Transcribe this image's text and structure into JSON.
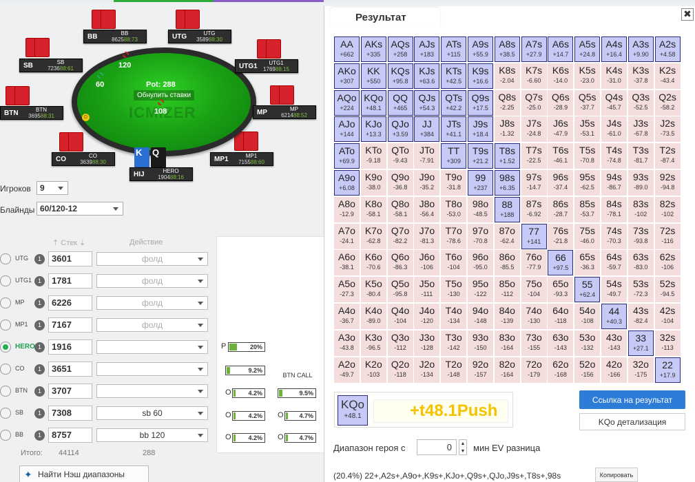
{
  "left": {
    "table": {
      "pot_label": "Pot: 288",
      "reset_label": "Обнулить ставки",
      "logo": "ICMIZER",
      "bets": {
        "bb": "120",
        "sb": "60",
        "hero": "108"
      },
      "dealer": "D",
      "hero_cards": [
        "K",
        "Q"
      ]
    },
    "seats": [
      {
        "pos": "BB",
        "name": "BB",
        "stack": "8625",
        "bb": "88:73"
      },
      {
        "pos": "UTG",
        "name": "UTG",
        "stack": "3589",
        "bb": "88:30"
      },
      {
        "pos": "UTG1",
        "name": "UTG1",
        "stack": "1769",
        "bb": "88:15"
      },
      {
        "pos": "MP",
        "name": "MP",
        "stack": "6214",
        "bb": "88:52"
      },
      {
        "pos": "MP1",
        "name": "MP1",
        "stack": "7155",
        "bb": "88:60"
      },
      {
        "pos": "HIJ",
        "name": "HERO",
        "stack": "1904",
        "bb": "88:16"
      },
      {
        "pos": "CO",
        "name": "CO",
        "stack": "3639",
        "bb": "88:30"
      },
      {
        "pos": "BTN",
        "name": "BTN",
        "stack": "3695",
        "bb": "88:31"
      },
      {
        "pos": "SB",
        "name": "SB",
        "stack": "7236",
        "bb": "88:61"
      }
    ],
    "players_label": "Игроков",
    "players_value": "9",
    "blinds_label": "Блайнды",
    "blinds_value": "60/120-12",
    "col_stack": "Стек",
    "col_action": "Действие",
    "rows": [
      {
        "pos": "UTG",
        "badge": "1",
        "stack": "3601",
        "action": "фолд"
      },
      {
        "pos": "UTG1",
        "badge": "1",
        "stack": "1781",
        "action": "фолд"
      },
      {
        "pos": "MP",
        "badge": "1",
        "stack": "6226",
        "action": "фолд"
      },
      {
        "pos": "MP1",
        "badge": "1",
        "stack": "7167",
        "action": "фолд"
      },
      {
        "pos": "HERO",
        "badge": "1",
        "stack": "1916",
        "action": ""
      },
      {
        "pos": "CO",
        "badge": "1",
        "stack": "3651",
        "action": ""
      },
      {
        "pos": "BTN",
        "badge": "1",
        "stack": "3707",
        "action": ""
      },
      {
        "pos": "SB",
        "badge": "1",
        "stack": "7308",
        "action": "sb 60"
      },
      {
        "pos": "BB",
        "badge": "1",
        "stack": "8757",
        "action": "bb 120"
      }
    ],
    "panel": {
      "p_label": "P",
      "p_pct": "20%",
      "co_pct": "9.2%",
      "btn_call": "BTN CALL",
      "btn_pct": "4.2%",
      "btn_call_pct": "9.5%",
      "sb_pct": "4.2%",
      "sb_call_pct": "4.7%",
      "bb_pct": "4.2%",
      "bb_call_pct": "4.7%",
      "o": "O"
    },
    "total_label": "Итого:",
    "total_stack": "44114",
    "total_pot": "288",
    "nash_label": "Найти Нэш диапазоны"
  },
  "right": {
    "tab": "Результат",
    "close": "✖",
    "grid": [
      [
        [
          "AA",
          "+662"
        ],
        [
          "AKs",
          "+335"
        ],
        [
          "AQs",
          "+258"
        ],
        [
          "AJs",
          "+183"
        ],
        [
          "ATs",
          "+115"
        ],
        [
          "A9s",
          "+55.9"
        ],
        [
          "A8s",
          "+38.5"
        ],
        [
          "A7s",
          "+27.9"
        ],
        [
          "A6s",
          "+14.7"
        ],
        [
          "A5s",
          "+24.8"
        ],
        [
          "A4s",
          "+16.4"
        ],
        [
          "A3s",
          "+9.90"
        ],
        [
          "A2s",
          "+4.58"
        ]
      ],
      [
        [
          "AKo",
          "+307"
        ],
        [
          "KK",
          "+550"
        ],
        [
          "KQs",
          "+95.8"
        ],
        [
          "KJs",
          "+63.6"
        ],
        [
          "KTs",
          "+42.5"
        ],
        [
          "K9s",
          "+16.6"
        ],
        [
          "K8s",
          "-2.04"
        ],
        [
          "K7s",
          "-6.60"
        ],
        [
          "K6s",
          "-14.0"
        ],
        [
          "K5s",
          "-23.0"
        ],
        [
          "K4s",
          "-31.0"
        ],
        [
          "K3s",
          "-37.8"
        ],
        [
          "K2s",
          "-43.4"
        ]
      ],
      [
        [
          "AQo",
          "+224"
        ],
        [
          "KQo",
          "+48.1"
        ],
        [
          "QQ",
          "+465"
        ],
        [
          "QJs",
          "+54.3"
        ],
        [
          "QTs",
          "+42.2"
        ],
        [
          "Q9s",
          "+17.5"
        ],
        [
          "Q8s",
          "-2.25"
        ],
        [
          "Q7s",
          "-25.0"
        ],
        [
          "Q6s",
          "-28.9"
        ],
        [
          "Q5s",
          "-37.7"
        ],
        [
          "Q4s",
          "-45.7"
        ],
        [
          "Q3s",
          "-52.5"
        ],
        [
          "Q2s",
          "-58.2"
        ]
      ],
      [
        [
          "AJo",
          "+144"
        ],
        [
          "KJo",
          "+13.3"
        ],
        [
          "QJo",
          "+3.59"
        ],
        [
          "JJ",
          "+384"
        ],
        [
          "JTs",
          "+41.1"
        ],
        [
          "J9s",
          "+18.4"
        ],
        [
          "J8s",
          "-1.32"
        ],
        [
          "J7s",
          "-24.8"
        ],
        [
          "J6s",
          "-47.9"
        ],
        [
          "J5s",
          "-53.1"
        ],
        [
          "J4s",
          "-61.0"
        ],
        [
          "J3s",
          "-67.8"
        ],
        [
          "J2s",
          "-73.5"
        ]
      ],
      [
        [
          "ATo",
          "+69.9"
        ],
        [
          "KTo",
          "-9.18"
        ],
        [
          "QTo",
          "-9.43"
        ],
        [
          "JTo",
          "-7.91"
        ],
        [
          "TT",
          "+309"
        ],
        [
          "T9s",
          "+21.2"
        ],
        [
          "T8s",
          "+1.52"
        ],
        [
          "T7s",
          "-22.5"
        ],
        [
          "T6s",
          "-46.1"
        ],
        [
          "T5s",
          "-70.8"
        ],
        [
          "T4s",
          "-74.8"
        ],
        [
          "T3s",
          "-81.7"
        ],
        [
          "T2s",
          "-87.4"
        ]
      ],
      [
        [
          "A9o",
          "+6.08"
        ],
        [
          "K9o",
          "-38.0"
        ],
        [
          "Q9o",
          "-36.8"
        ],
        [
          "J9o",
          "-35.2"
        ],
        [
          "T9o",
          "-31.8"
        ],
        [
          "99",
          "+237"
        ],
        [
          "98s",
          "+6.35"
        ],
        [
          "97s",
          "-14.7"
        ],
        [
          "96s",
          "-37.4"
        ],
        [
          "95s",
          "-62.5"
        ],
        [
          "94s",
          "-86.7"
        ],
        [
          "93s",
          "-89.0"
        ],
        [
          "92s",
          "-94.8"
        ]
      ],
      [
        [
          "A8o",
          "-12.9"
        ],
        [
          "K8o",
          "-58.1"
        ],
        [
          "Q8o",
          "-58.1"
        ],
        [
          "J8o",
          "-56.4"
        ],
        [
          "T8o",
          "-53.0"
        ],
        [
          "98o",
          "-48.5"
        ],
        [
          "88",
          "+188"
        ],
        [
          "87s",
          "-6.92"
        ],
        [
          "86s",
          "-28.7"
        ],
        [
          "85s",
          "-53.7"
        ],
        [
          "84s",
          "-78.1"
        ],
        [
          "83s",
          "-102"
        ],
        [
          "82s",
          "-102"
        ]
      ],
      [
        [
          "A7o",
          "-24.1"
        ],
        [
          "K7o",
          "-62.8"
        ],
        [
          "Q7o",
          "-82.2"
        ],
        [
          "J7o",
          "-81.3"
        ],
        [
          "T7o",
          "-78.6"
        ],
        [
          "97o",
          "-70.8"
        ],
        [
          "87o",
          "-62.4"
        ],
        [
          "77",
          "+141"
        ],
        [
          "76s",
          "-21.8"
        ],
        [
          "75s",
          "-46.0"
        ],
        [
          "74s",
          "-70.3"
        ],
        [
          "73s",
          "-93.8"
        ],
        [
          "72s",
          "-116"
        ]
      ],
      [
        [
          "A6o",
          "-38.1"
        ],
        [
          "K6o",
          "-70.6"
        ],
        [
          "Q6o",
          "-86.3"
        ],
        [
          "J6o",
          "-106"
        ],
        [
          "T6o",
          "-104"
        ],
        [
          "96o",
          "-95.0"
        ],
        [
          "86o",
          "-85.5"
        ],
        [
          "76o",
          "-77.9"
        ],
        [
          "66",
          "+97.5"
        ],
        [
          "65s",
          "-36.3"
        ],
        [
          "64s",
          "-59.7"
        ],
        [
          "63s",
          "-83.0"
        ],
        [
          "62s",
          "-106"
        ]
      ],
      [
        [
          "A5o",
          "-27.3"
        ],
        [
          "K5o",
          "-80.4"
        ],
        [
          "Q5o",
          "-95.8"
        ],
        [
          "J5o",
          "-111"
        ],
        [
          "T5o",
          "-130"
        ],
        [
          "95o",
          "-122"
        ],
        [
          "85o",
          "-112"
        ],
        [
          "75o",
          "-104"
        ],
        [
          "65o",
          "-93.3"
        ],
        [
          "55",
          "+62.4"
        ],
        [
          "54s",
          "-49.7"
        ],
        [
          "53s",
          "-72.3"
        ],
        [
          "52s",
          "-94.5"
        ]
      ],
      [
        [
          "A4o",
          "-36.7"
        ],
        [
          "K4o",
          "-89.0"
        ],
        [
          "Q4o",
          "-104"
        ],
        [
          "J4o",
          "-120"
        ],
        [
          "T4o",
          "-134"
        ],
        [
          "94o",
          "-148"
        ],
        [
          "84o",
          "-139"
        ],
        [
          "74o",
          "-130"
        ],
        [
          "64o",
          "-118"
        ],
        [
          "54o",
          "-108"
        ],
        [
          "44",
          "+40.3"
        ],
        [
          "43s",
          "-82.4"
        ],
        [
          "42s",
          "-104"
        ]
      ],
      [
        [
          "A3o",
          "-43.8"
        ],
        [
          "K3o",
          "-96.5"
        ],
        [
          "Q3o",
          "-112"
        ],
        [
          "J3o",
          "-128"
        ],
        [
          "T3o",
          "-142"
        ],
        [
          "93o",
          "-150"
        ],
        [
          "83o",
          "-164"
        ],
        [
          "73o",
          "-155"
        ],
        [
          "63o",
          "-143"
        ],
        [
          "53o",
          "-132"
        ],
        [
          "43o",
          "-143"
        ],
        [
          "33",
          "+27.1"
        ],
        [
          "32s",
          "-113"
        ]
      ],
      [
        [
          "A2o",
          "-49.7"
        ],
        [
          "K2o",
          "-103"
        ],
        [
          "Q2o",
          "-118"
        ],
        [
          "J2o",
          "-134"
        ],
        [
          "T2o",
          "-148"
        ],
        [
          "92o",
          "-157"
        ],
        [
          "82o",
          "-164"
        ],
        [
          "72o",
          "-179"
        ],
        [
          "62o",
          "-168"
        ],
        [
          "52o",
          "-156"
        ],
        [
          "42o",
          "-166"
        ],
        [
          "32o",
          "-175"
        ],
        [
          "22",
          "+17.9"
        ]
      ]
    ],
    "detail": {
      "hand": "KQo",
      "ev": "+48.1",
      "result": "+t48.1Push"
    },
    "link_button": "Ссылка на результат",
    "detail_button": "KQo детализация",
    "range_label": "Диапазон героя с",
    "range_min": "0",
    "range_suffix": "мин EV разница",
    "range_string": "(20.4%) 22+,A2s+,A9o+,K9s+,KJo+,Q9s+,QJo,J9s+,T8s+,98s",
    "copy_button": "Копировать"
  }
}
